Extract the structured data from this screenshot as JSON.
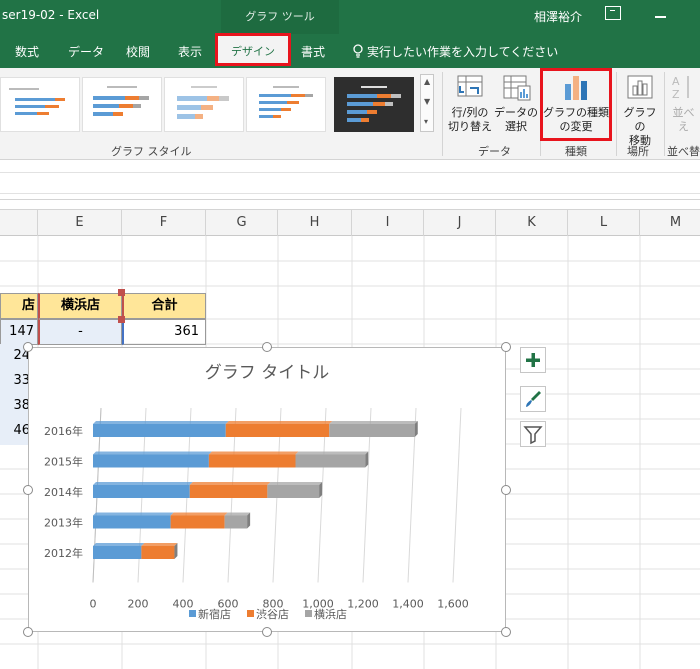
{
  "window": {
    "title": "ser19-02  -  Excel",
    "context_tab": "グラフ ツール",
    "user": "相澤裕介"
  },
  "tabs": [
    {
      "label": "数式"
    },
    {
      "label": "データ"
    },
    {
      "label": "校閲"
    },
    {
      "label": "表示"
    },
    {
      "label": "デザイン"
    },
    {
      "label": "書式"
    }
  ],
  "tell_me": "実行したい作業を入力してください",
  "ribbon": {
    "chart_styles_label": "グラフ スタイル",
    "switch_row_col": [
      "行/列の",
      "切り替え"
    ],
    "select_data": [
      "データの",
      "選択"
    ],
    "data_group": "データ",
    "change_chart_type": [
      "グラフの種類",
      "の変更"
    ],
    "type_group": "種類",
    "move_chart": [
      "グラフの",
      "移動"
    ],
    "location_group": "場所",
    "sort": [
      "並べ",
      "え"
    ],
    "sort_group": "並べ替"
  },
  "columns": [
    "E",
    "F",
    "G",
    "H",
    "I",
    "J",
    "K",
    "L",
    "M"
  ],
  "table": {
    "header_partial": "店",
    "header_yokohama": "横浜店",
    "header_total": "合計",
    "r1_partial": "147",
    "r1_yokohama": "-",
    "r1_total": "361",
    "partials": [
      "24",
      "33",
      "38",
      "46"
    ]
  },
  "colors": {
    "shinjuku": "#5b9bd5",
    "shibuya": "#ed7d31",
    "yokohama": "#a5a5a5",
    "excel_green": "#217346",
    "highlight_red": "#e8141d"
  },
  "chart_data": {
    "type": "bar",
    "orientation": "horizontal",
    "stacked": true,
    "title": "グラフ タイトル",
    "categories": [
      "2016年",
      "2015年",
      "2014年",
      "2013年",
      "2012年"
    ],
    "series": [
      {
        "name": "新宿店",
        "values": [
          590,
          515,
          430,
          345,
          215
        ]
      },
      {
        "name": "渋谷店",
        "values": [
          460,
          385,
          345,
          240,
          147
        ]
      },
      {
        "name": "横浜店",
        "values": [
          380,
          310,
          230,
          100,
          0
        ]
      }
    ],
    "xticks": [
      "0",
      "200",
      "400",
      "600",
      "800",
      "1,000",
      "1,200",
      "1,400",
      "1,600"
    ],
    "xlim": [
      0,
      1600
    ],
    "legend": "bottom",
    "grid": true
  }
}
